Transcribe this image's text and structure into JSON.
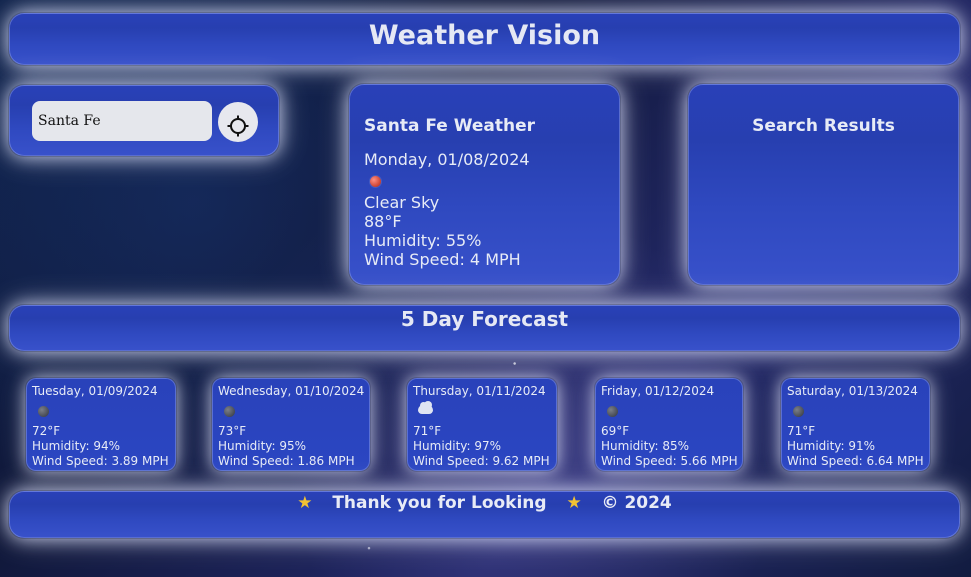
{
  "header": {
    "title": "Weather Vision"
  },
  "search": {
    "value": "Santa Fe",
    "button_icon": "crosshair-icon"
  },
  "current": {
    "title": "Santa Fe Weather",
    "date": "Monday, 01/08/2024",
    "icon": "sun-icon",
    "condition": "Clear Sky",
    "temperature": "88°F",
    "humidity": "Humidity: 55%",
    "wind": "Wind Speed: 4 MPH"
  },
  "results": {
    "title": "Search Results"
  },
  "forecast": {
    "title": "5 Day Forecast",
    "days": [
      {
        "date": "Tuesday, 01/09/2024",
        "icon": "moon-icon",
        "temperature": "72°F",
        "humidity": "Humidity: 94%",
        "wind": "Wind Speed: 3.89 MPH"
      },
      {
        "date": "Wednesday, 01/10/2024",
        "icon": "moon-icon",
        "temperature": "73°F",
        "humidity": "Humidity: 95%",
        "wind": "Wind Speed: 1.86 MPH"
      },
      {
        "date": "Thursday, 01/11/2024",
        "icon": "cloud-icon",
        "temperature": "71°F",
        "humidity": "Humidity: 97%",
        "wind": "Wind Speed: 9.62 MPH"
      },
      {
        "date": "Friday, 01/12/2024",
        "icon": "moon-icon",
        "temperature": "69°F",
        "humidity": "Humidity: 85%",
        "wind": "Wind Speed: 5.66 MPH"
      },
      {
        "date": "Saturday, 01/13/2024",
        "icon": "moon-icon",
        "temperature": "71°F",
        "humidity": "Humidity: 91%",
        "wind": "Wind Speed: 6.64 MPH"
      }
    ]
  },
  "footer": {
    "message": "Thank you for Looking",
    "copyright": "© 2024",
    "icon": "star-icon"
  },
  "colors": {
    "panel": "#2b44bf",
    "glow": "#ffffff",
    "star": "#f2c233",
    "input": "#e5e7ec",
    "sun": "#d34b3a",
    "moon": "#4a4e58",
    "cloud": "#dfe4f2"
  }
}
